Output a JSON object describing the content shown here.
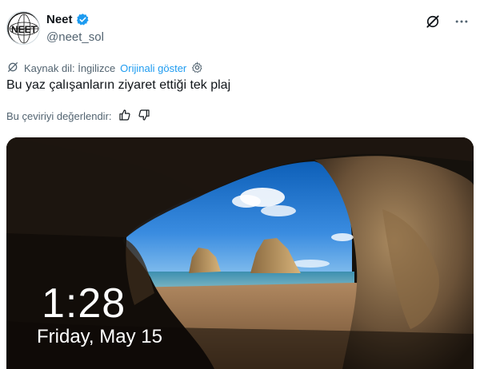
{
  "tweet": {
    "display_name": "Neet",
    "handle": "@neet_sol",
    "avatar_text": "NEET",
    "translation_source": "Kaynak dil: İngilizce",
    "show_original": "Orijinali göster",
    "text": "Bu yaz çalışanların ziyaret ettiği tek plaj",
    "rate_label": "Bu çeviriyi değerlendir:"
  },
  "lockscreen": {
    "time": "1:28",
    "date": "Friday, May 15"
  },
  "icons": {
    "verified": "verified-badge-icon",
    "grok": "grok-icon",
    "more": "more-icon",
    "translate": "translate-icon",
    "settings": "gear-icon",
    "thumbs_up": "thumbs-up-icon",
    "thumbs_down": "thumbs-down-icon"
  },
  "colors": {
    "accent": "#1d9bf0",
    "text": "#0f1419",
    "secondary": "#536471"
  }
}
